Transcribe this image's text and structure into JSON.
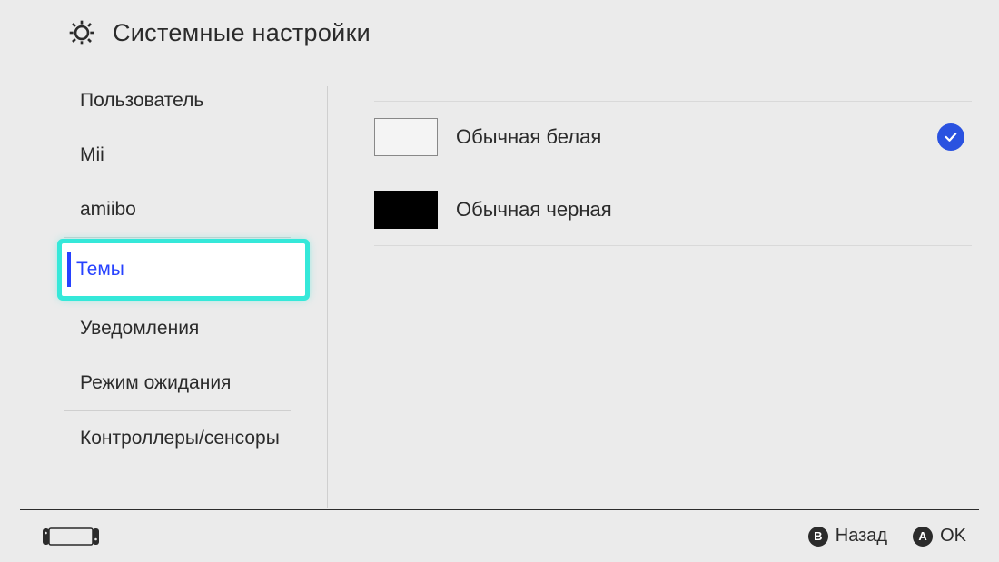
{
  "header": {
    "title": "Системные настройки"
  },
  "sidebar": {
    "items": [
      {
        "label": "Пользователь"
      },
      {
        "label": "Mii"
      },
      {
        "label": "amiibo"
      },
      {
        "label": "Темы",
        "selected": true
      },
      {
        "label": "Уведомления"
      },
      {
        "label": "Режим ожидания"
      },
      {
        "label": "Контроллеры/сенсоры"
      }
    ]
  },
  "themes": {
    "items": [
      {
        "label": "Обычная белая",
        "swatch": "white",
        "selected": true
      },
      {
        "label": "Обычная черная",
        "swatch": "black",
        "selected": false
      }
    ]
  },
  "footer": {
    "back_button": "B",
    "back_label": "Назад",
    "ok_button": "A",
    "ok_label": "OK"
  }
}
